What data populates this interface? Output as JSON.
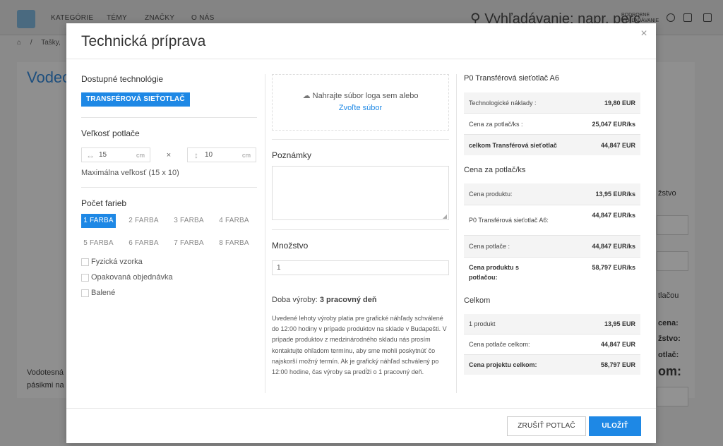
{
  "background": {
    "nav": [
      "KATEGÓRIE",
      "TÉMY",
      "ZNAČKY",
      "O NÁS"
    ],
    "search_placeholder": "Vyhľadávanie: napr. perc",
    "search_detail": "PODROBNÉ VYHĽADÁVANIE",
    "breadcrumb": "Tašky,",
    "page_title": "Vodec",
    "desc_line1": "Vodotesná",
    "desc_line2": "pásikmi na",
    "right_labels": [
      "žstvo",
      "tlačou",
      "cena:",
      "žstvo:",
      "otlač:",
      "om:"
    ]
  },
  "modal": {
    "title": "Technická príprava",
    "close_icon": "close-icon",
    "col1": {
      "tech_label": "Dostupné technológie",
      "tech_button": "TRANSFÉROVÁ SIEŤOTLAČ",
      "size_label": "Veľkosť potlače",
      "width_value": "15",
      "height_value": "10",
      "unit": "cm",
      "times": "×",
      "max_size": "Maximálna veľkosť (15 x 10)",
      "colors_label": "Počet farieb",
      "colors": [
        "1 FARBA",
        "2 FARBA",
        "3 FARBA",
        "4 FARBA",
        "5 FARBA",
        "6 FARBA",
        "7 FARBA",
        "8 FARBA"
      ],
      "selected_color": "1 FARBA",
      "checkboxes": [
        "Fyzická vzorka",
        "Opakovaná objednávka",
        "Balené"
      ]
    },
    "col2": {
      "upload_text": "Nahrajte súbor loga sem alebo",
      "upload_link": "Zvoľte súbor",
      "notes_label": "Poznámky",
      "qty_label": "Množstvo",
      "qty_value": "1",
      "prod_label": "Doba výroby:",
      "prod_value": "3 pracovný deň",
      "prod_note": "Uvedené lehoty výroby platia pre grafické náhľady schválené do 12:00 hodiny v prípade produktov na sklade v Budapešti. V prípade produktov z medzinárodného skladu nás prosím kontaktujte ohľadom termínu, aby sme mohli poskytnúť čo najskorší možný termín. Ak je grafický náhľad schválený po 12:00 hodine, čas výroby sa predĺži o 1 pracovný deň."
    },
    "col3": {
      "sec1_title": "P0 Transférová sieťotlač A6",
      "sec1_rows": [
        {
          "label": "Technologické náklady :",
          "value": "19,80 EUR"
        },
        {
          "label": "Cena za potlač/ks :",
          "value": "25,047 EUR/ks"
        },
        {
          "label": "celkom Transférová sieťotlač",
          "value": "44,847 EUR"
        }
      ],
      "sec2_title": "Cena za potlač/ks",
      "sec2_rows": [
        {
          "label": "Cena produktu:",
          "value": "13,95 EUR/ks"
        },
        {
          "label": "P0 Transférová sieťotlač A6:",
          "value": "44,847 EUR/ks"
        },
        {
          "label": "Cena potlače :",
          "value": "44,847 EUR/ks"
        },
        {
          "label": "Cena produktu s potlačou:",
          "value": "58,797 EUR/ks"
        }
      ],
      "sec3_title": "Celkom",
      "sec3_rows": [
        {
          "label": "1 produkt",
          "value": "13,95 EUR"
        },
        {
          "label": "Cena potlače celkom:",
          "value": "44,847 EUR"
        },
        {
          "label": "Cena projektu celkom:",
          "value": "58,797 EUR"
        }
      ]
    },
    "footer": {
      "cancel": "ZRUŠIŤ POTLAČ",
      "save": "ULOŽIŤ"
    }
  },
  "colors": {
    "accent": "#1e88e5"
  }
}
